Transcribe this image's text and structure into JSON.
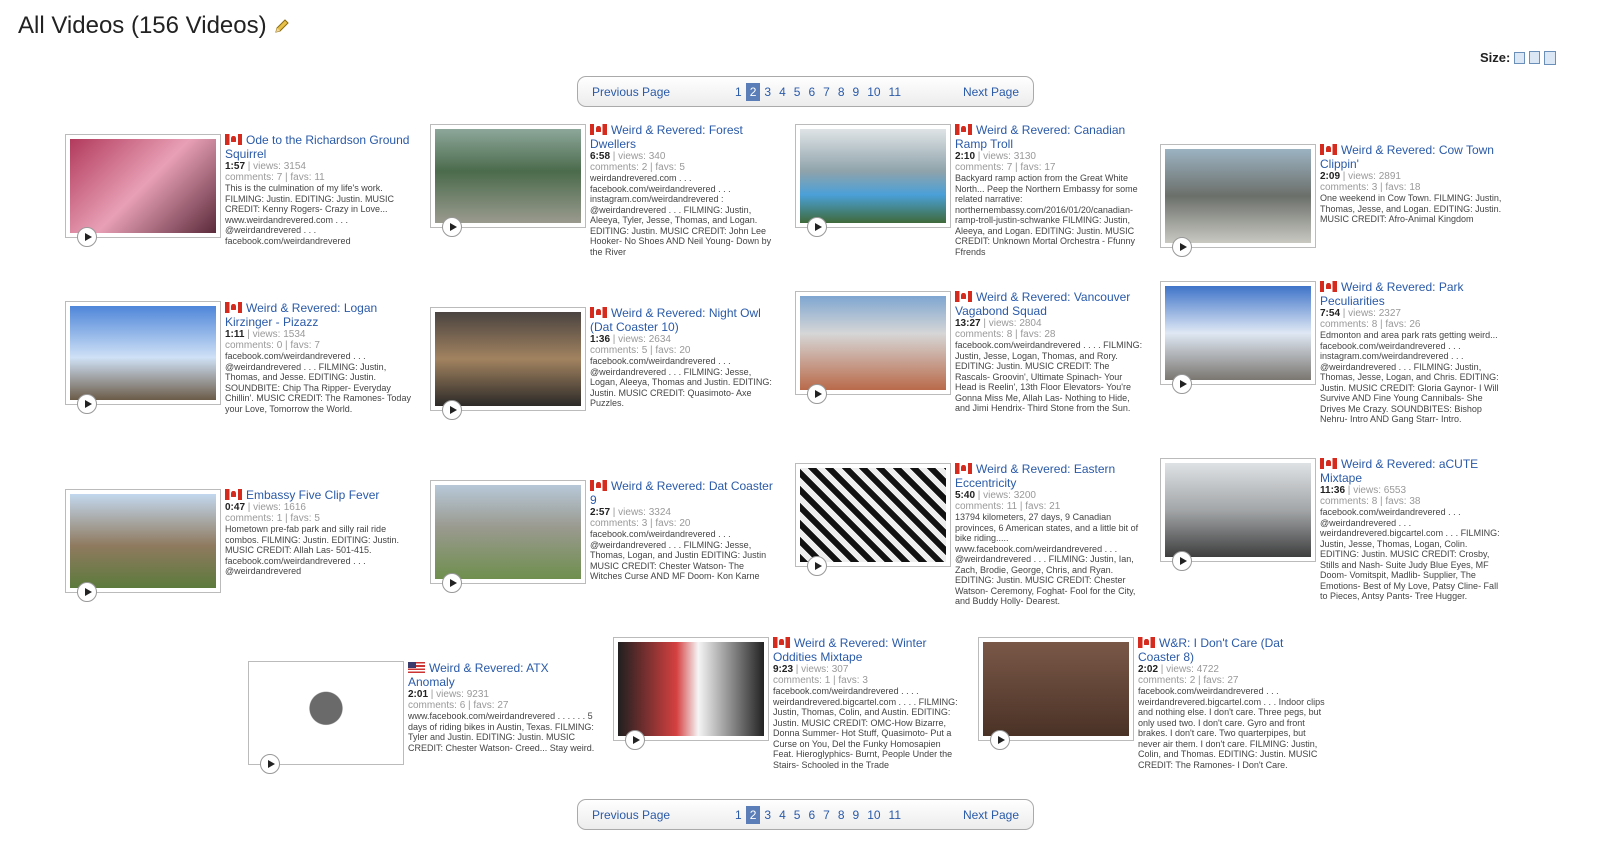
{
  "header": {
    "title": "All Videos (156 Videos)",
    "size_label": "Size:"
  },
  "pagination": {
    "prev_label": "Previous Page",
    "next_label": "Next Page",
    "pages": [
      "1",
      "2",
      "3",
      "4",
      "5",
      "6",
      "7",
      "8",
      "9",
      "10",
      "11"
    ],
    "current": "2"
  },
  "videos": [
    {
      "title": "Ode to the Richardson Ground Squirrel",
      "flag": "ca",
      "duration": "1:57",
      "views": "3154",
      "comments": "7",
      "favs": "11",
      "description": "This is the culmination of my life's work. FILMING: Justin. EDITING: Justin. MUSIC CREDIT: Kenny Rogers- Crazy in Love... www.weirdandrevered.com . . . @weirdandrevered . . . facebook.com/weirdandrevered"
    },
    {
      "title": "Weird & Revered: Forest Dwellers",
      "flag": "ca",
      "duration": "6:58",
      "views": "340",
      "comments": "2",
      "favs": "5",
      "description": "weirdandrevered.com . . . facebook.com/weirdandrevered . . . instagram.com/weirdandrevered : @weirdandrevered . . . FILMING: Justin, Aleeya, Tyler, Jesse, Thomas, and Logan. EDITING: Justin. MUSIC CREDIT: John Lee Hooker- No Shoes AND Neil Young- Down by the River"
    },
    {
      "title": "Weird & Revered: Canadian Ramp Troll",
      "flag": "ca",
      "duration": "2:10",
      "views": "3130",
      "comments": "7",
      "favs": "17",
      "description": "Backyard ramp action from the Great White North... Peep the Northern Embassy for some related narrative: northernembassy.com/2016/01/20/canadian-ramp-troll-justin-schwanke FILMING: Justin, Aleeya, and Logan. EDITING: Justin. MUSIC CREDIT: Unknown Mortal Orchestra - Ffunny Ffrends"
    },
    {
      "title": "Weird & Revered: Cow Town Clippin'",
      "flag": "ca",
      "duration": "2:09",
      "views": "2891",
      "comments": "3",
      "favs": "18",
      "description": "One weekend in Cow Town. FILMING: Justin, Thomas, Jesse, and Logan. EDITING: Justin. MUSIC CREDIT: Afro-Animal Kingdom"
    },
    {
      "title": "Weird & Revered: Logan Kirzinger - Pizazz",
      "flag": "ca",
      "duration": "1:11",
      "views": "1534",
      "comments": "0",
      "favs": "7",
      "description": "facebook.com/weirdandrevered . . . @weirdandrevered . . . FILMING: Justin, Thomas, and Jesse. EDITING: Justin. SOUNDBITE: Chip Tha Ripper- Everyday Chillin'. MUSIC CREDIT: The Ramones- Today your Love, Tomorrow the World."
    },
    {
      "title": "Weird & Revered: Night Owl (Dat Coaster 10)",
      "flag": "ca",
      "duration": "1:36",
      "views": "2634",
      "comments": "5",
      "favs": "20",
      "description": "facebook.com/weirdandrevered . . . @weirdandrevered . . . FILMING: Jesse, Logan, Aleeya, Thomas and Justin. EDITING: Justin. MUSIC CREDIT: Quasimoto- Axe Puzzles."
    },
    {
      "title": "Weird & Revered: Vancouver Vagabond Squad",
      "flag": "ca",
      "duration": "13:27",
      "views": "2804",
      "comments": "8",
      "favs": "28",
      "description": "facebook.com/weirdandrevered . . . . FILMING: Justin, Jesse, Logan, Thomas, and Rory. EDITING: Justin. MUSIC CREDIT: The Rascals- Groovin', Ultimate Spinach- Your Head is Reelin', 13th Floor Elevators- You're Gonna Miss Me, Allah Las- Nothing to Hide, and Jimi Hendrix- Third Stone from the Sun."
    },
    {
      "title": "Weird & Revered: Park Peculiarities",
      "flag": "ca",
      "duration": "7:54",
      "views": "2327",
      "comments": "8",
      "favs": "26",
      "description": "Edmonton and area park rats getting weird... facebook.com/weirdandrevered . . . instagram.com/weirdandrevered . . . @weirdandrevered . . . FILMING: Justin, Thomas, Jesse, Logan, and Chris. EDITING: Justin. MUSIC CREDIT: Gloria Gaynor- I Will Survive AND Fine Young Cannibals- She Drives Me Crazy. SOUNDBITES: Bishop Nehru- Intro AND Gang Starr- Intro."
    },
    {
      "title": "Embassy Five Clip Fever",
      "flag": "ca",
      "duration": "0:47",
      "views": "1616",
      "comments": "1",
      "favs": "5",
      "description": "Hometown pre-fab park and silly rail ride combos. FILMING: Justin. EDITING: Justin. MUSIC CREDIT: Allah Las- 501-415. facebook.com/weirdandrevered . . . @weirdandrevered"
    },
    {
      "title": "Weird & Revered: Dat Coaster 9",
      "flag": "ca",
      "duration": "2:57",
      "views": "3324",
      "comments": "3",
      "favs": "20",
      "description": "facebook.com/weirdandrevered . . . @weirdandrevered . . . FILMING: Jesse, Thomas, Logan, and Justin EDITING: Justin MUSIC CREDIT: Chester Watson- The Witches Curse AND MF Doom- Kon Karne"
    },
    {
      "title": "Weird & Revered: Eastern Eccentricity",
      "flag": "ca",
      "duration": "5:40",
      "views": "3200",
      "comments": "11",
      "favs": "21",
      "description": "13794 kilometers, 27 days, 9 Canadian provinces, 6 American states, and a little bit of bike riding..... www.facebook.com/weirdandrevered . . . @weirdandrevered . . . FILMING: Justin, Ian, Zach, Brodie, George, Chris, and Ryan. EDITING: Justin. MUSIC CREDIT: Chester Watson- Ceremony, Foghat- Fool for the City, and Buddy Holly- Dearest."
    },
    {
      "title": "Weird & Revered: aCUTE Mixtape",
      "flag": "ca",
      "duration": "11:36",
      "views": "6553",
      "comments": "8",
      "favs": "38",
      "description": "facebook.com/weirdandrevered . . . @weirdandrevered . . . weirdandrevered.bigcartel.com . . . FILMING: Justin, Jesse, Thomas, Logan, Colin. EDITING: Justin. MUSIC CREDIT: Crosby, Stills and Nash- Suite Judy Blue Eyes, MF Doom- Vomitspit, Madlib- Supplier, The Emotions- Best of My Love, Patsy Cline- Fall to Pieces, Antsy Pants- Tree Hugger."
    },
    {
      "title": "Weird & Revered: ATX Anomaly",
      "flag": "us",
      "duration": "2:01",
      "views": "9231",
      "comments": "6",
      "favs": "27",
      "description": "www.facebook.com/weirdandrevered . . . . . . 5 days of riding bikes in Austin, Texas. FILMING: Tyler and Justin. EDITING: Justin. MUSIC CREDIT: Chester Watson- Creed... Stay weird."
    },
    {
      "title": "Weird & Revered: Winter Oddities Mixtape",
      "flag": "ca",
      "duration": "9:23",
      "views": "307",
      "comments": "1",
      "favs": "3",
      "description": "facebook.com/weirdandrevered . . . . weirdandrevered.bigcartel.com . . . . FILMING: Justin, Thomas, Colin, and Austin. EDITING: Justin. MUSIC CREDIT: OMC-How Bizarre, Donna Summer- Hot Stuff, Quasimoto- Put a Curse on You, Del the Funky Homosapien Feat. Hieroglyphics- Burnt, People Under the Stairs- Schooled in the Trade"
    },
    {
      "title": "W&R: I Don't Care (Dat Coaster 8)",
      "flag": "ca",
      "duration": "2:02",
      "views": "4722",
      "comments": "2",
      "favs": "27",
      "description": "facebook.com/weirdandrevered . . . weirdandrevered.bigcartel.com . . . Indoor clips and nothing else. I don't care. Three pegs, but only used two. I don't care. Gyro and front brakes. I don't care. Two quarterpipes, but never air them. I don't care. FILMING: Justin, Colin, and Thomas. EDITING: Justin. MUSIC CREDIT: The Ramones- I Don't Care."
    }
  ],
  "labels": {
    "views": "views:",
    "comments": "comments:",
    "favs": "favs:"
  }
}
